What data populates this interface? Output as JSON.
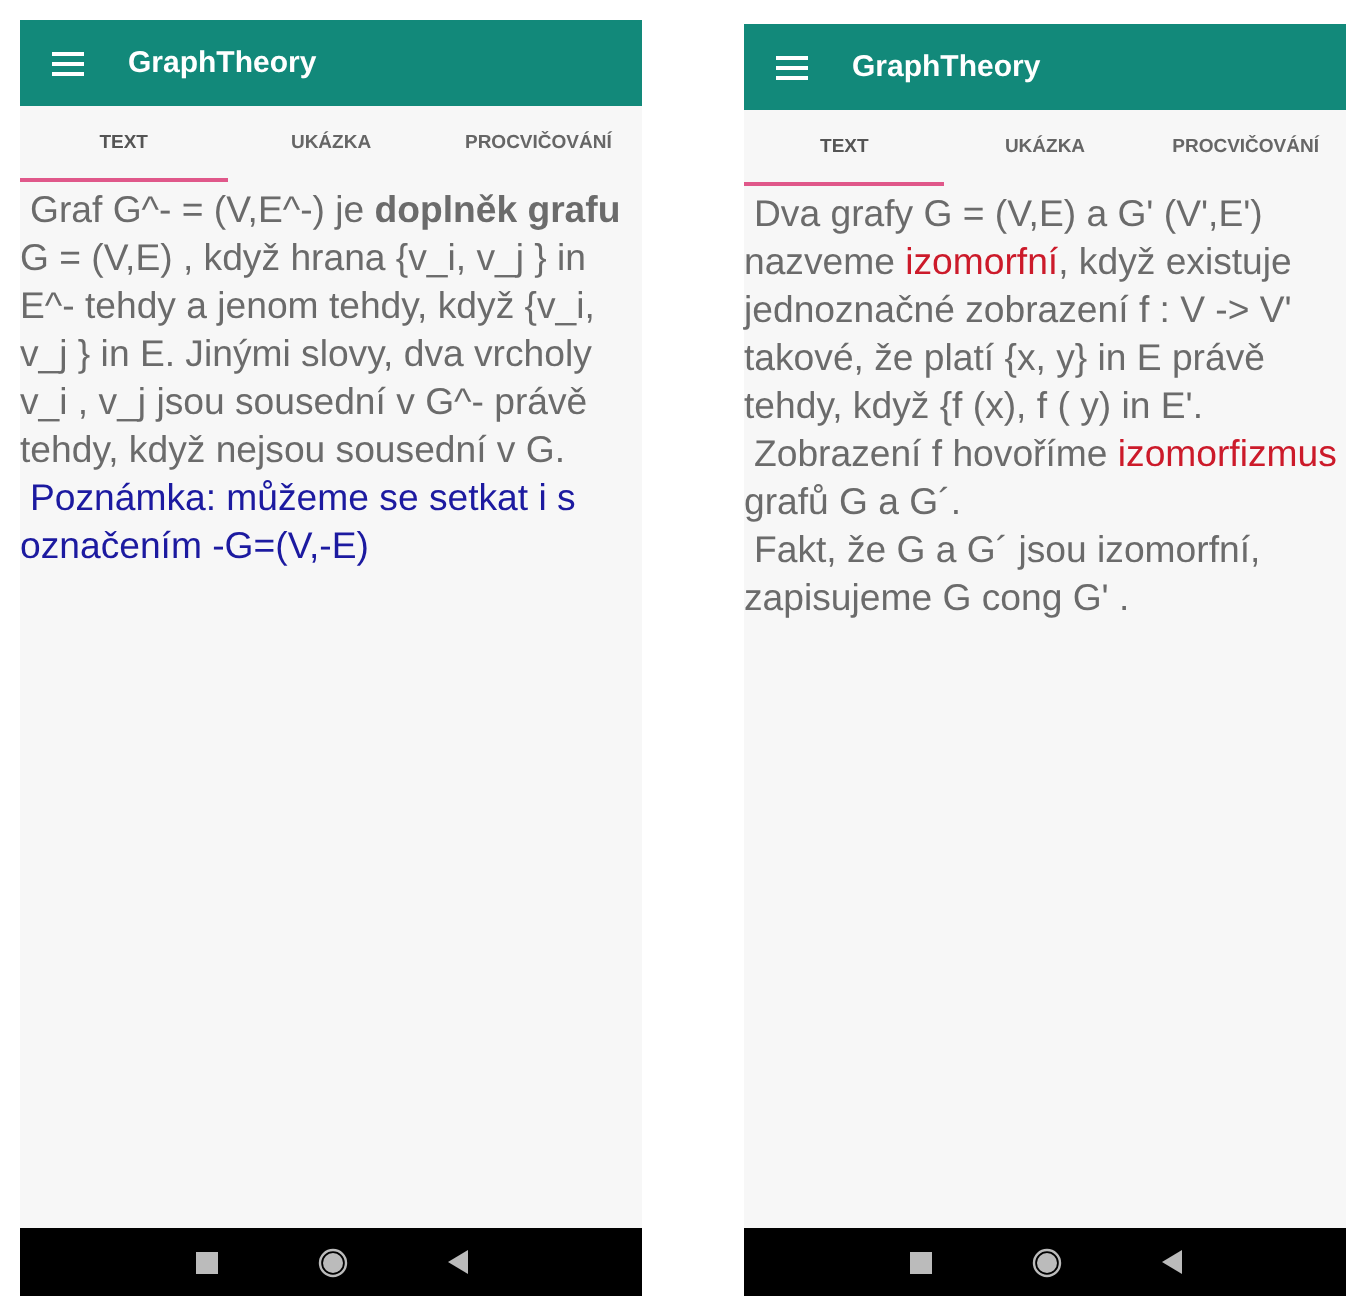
{
  "phones": [
    {
      "app_bar": {
        "title": "GraphTheory"
      },
      "tabs": [
        {
          "label": "TEXT",
          "selected": true
        },
        {
          "label": "UKÁZKA",
          "selected": false
        },
        {
          "label": "PROCVIČOVÁNÍ",
          "selected": false
        }
      ],
      "paragraphs": [
        {
          "kind": "body",
          "segments": [
            {
              "text": "Graf G^- = (V,E^-) je ",
              "kind": "plain"
            },
            {
              "text": "doplněk grafu",
              "kind": "bold"
            },
            {
              "text": " G = (V,E) , když hrana {v_i, v_j } in E^- tehdy a jenom tehdy, když {v_i, v_j } in E. Jinými slovy, dva vrcholy v_i , v_j jsou sousední v G^- právě tehdy, když nejsou sousední v G.",
              "kind": "plain"
            }
          ]
        },
        {
          "kind": "note",
          "segments": [
            {
              "text": "Poznámka: můžeme se setkat i s označením -G=(V,-E)",
              "kind": "plain"
            }
          ]
        }
      ]
    },
    {
      "app_bar": {
        "title": "GraphTheory"
      },
      "tabs": [
        {
          "label": "TEXT",
          "selected": true
        },
        {
          "label": "UKÁZKA",
          "selected": false
        },
        {
          "label": "PROCVIČOVÁNÍ",
          "selected": false
        }
      ],
      "paragraphs": [
        {
          "kind": "body",
          "segments": [
            {
              "text": "Dva grafy G = (V,E) a G' (V',E') nazveme ",
              "kind": "plain"
            },
            {
              "text": "izomorfní",
              "kind": "term"
            },
            {
              "text": ", když existuje jednoznačné zobrazení f : V -> V' takové, že platí {x, y} in E právě tehdy, když {f (x), f ( y) in E'.",
              "kind": "plain"
            }
          ]
        },
        {
          "kind": "body",
          "segments": [
            {
              "text": "Zobrazení f hovoříme ",
              "kind": "plain"
            },
            {
              "text": "izomorfizmus",
              "kind": "term"
            },
            {
              "text": " grafů G a G´.",
              "kind": "plain"
            }
          ]
        },
        {
          "kind": "body",
          "segments": [
            {
              "text": "Fakt, že G a G´ jsou izomorfní, zapisujeme G cong G' .",
              "kind": "plain"
            }
          ]
        }
      ]
    }
  ]
}
